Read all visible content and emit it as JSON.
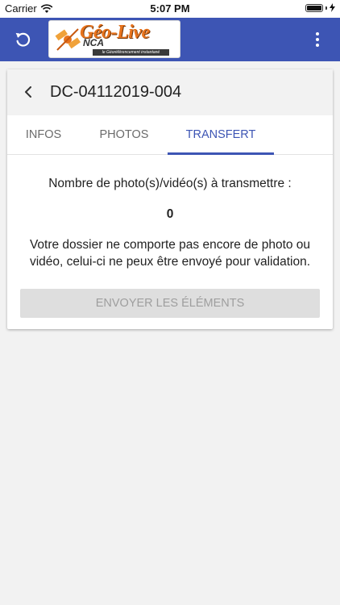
{
  "status_bar": {
    "carrier": "Carrier",
    "time": "5:07 PM",
    "battery_level": 1.0
  },
  "app_bar": {
    "logo": {
      "main": "Géo-Live",
      "sub": "NCA",
      "tagline": "le Géoréférencement instantané"
    },
    "icons": [
      "refresh-icon",
      "more-vert-icon"
    ],
    "color": "#3d55b4"
  },
  "card": {
    "title": "DC-04112019-004",
    "tabs": [
      {
        "label": "INFOS",
        "active": false
      },
      {
        "label": "PHOTOS",
        "active": false
      },
      {
        "label": "TRANSFERT",
        "active": true
      }
    ],
    "transfer": {
      "count_label": "Nombre de photo(s)/vidéo(s) à transmettre :",
      "count_value": "0",
      "notice_line1": "Votre dossier ne comporte pas encore de photo ou",
      "notice_line2": "vidéo, celui-ci ne peux être envoyé pour validation.",
      "button_label": "ENVOYER LES ÉLÉMENTS",
      "button_enabled": false
    }
  }
}
